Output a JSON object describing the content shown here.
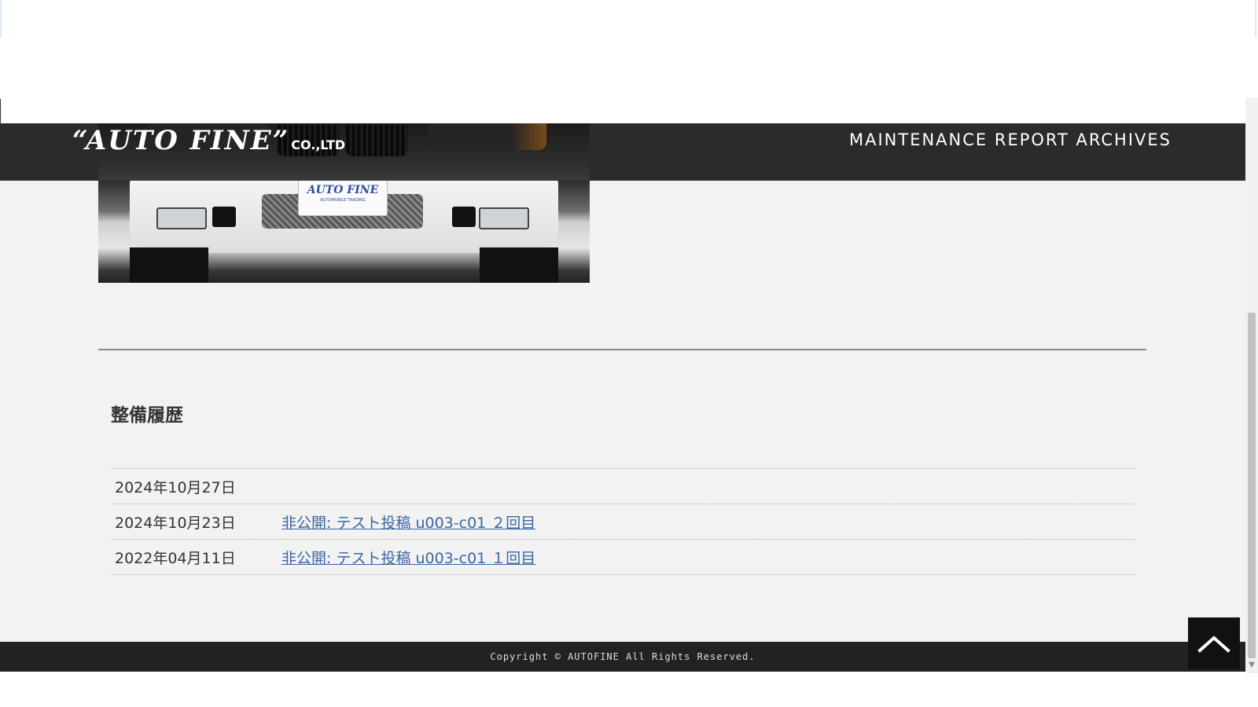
{
  "header": {
    "logo_brand": "“AUTO FINE”",
    "logo_suffix": "CO.,LTD",
    "title": "MAINTENANCE REPORT ARCHIVES"
  },
  "photo": {
    "plate_text": "AUTO FINE",
    "plate_subtext": "AUTOMOBILE TRADING"
  },
  "history": {
    "heading": "整備履歴",
    "rows": [
      {
        "date": "2024年10月27日",
        "link": ""
      },
      {
        "date": "2024年10月23日",
        "link": "非公開: テスト投稿 u003-c01 ２回目"
      },
      {
        "date": "2022年04月11日",
        "link": "非公開: テスト投稿 u003-c01 １回目"
      }
    ]
  },
  "footer": {
    "copyright": "Copyright © AUTOFINE All Rights Reserved."
  },
  "page_top_button": {
    "icon": "chevron-up-icon"
  },
  "colors": {
    "header_bg": "#222222",
    "page_bg": "#f2f2f2",
    "link": "#3a66a3",
    "footer_bg": "#222222"
  }
}
